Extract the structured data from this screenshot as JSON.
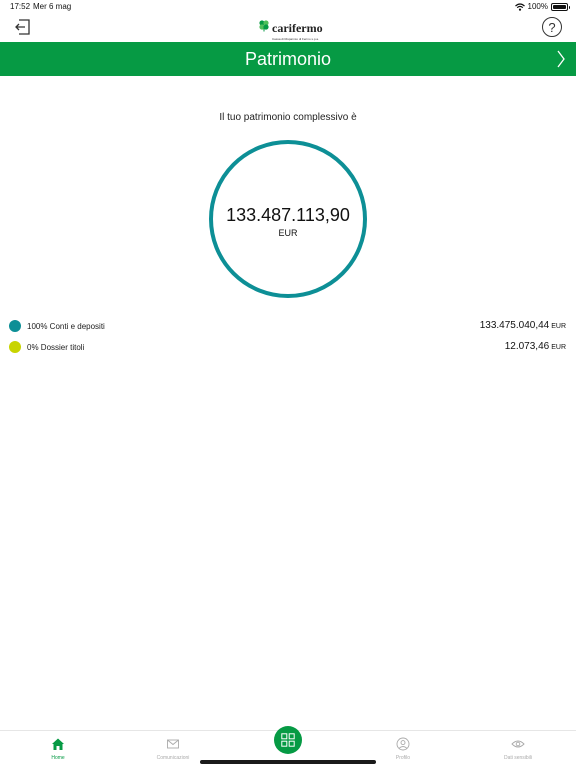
{
  "status_bar": {
    "time": "17:52",
    "date": "Mer 6 mag",
    "battery": "100%",
    "battery_level": 1.0
  },
  "header": {
    "logo_name": "carifermo",
    "logo_subtitle": "Cassa di Risparmio di Fermo s.p.a.",
    "help_label": "?"
  },
  "title_bar": {
    "title": "Patrimonio"
  },
  "summary": {
    "label": "Il tuo patrimonio complessivo è",
    "amount": "133.487.113,90",
    "currency": "EUR"
  },
  "breakdown": [
    {
      "label": "100% Conti e depositi",
      "value": "133.475.040,44",
      "currency": "EUR",
      "color": "#0d8f96"
    },
    {
      "label": "0% Dossier titoli",
      "value": "12.073,46",
      "currency": "EUR",
      "color": "#c8d400"
    }
  ],
  "tabs": [
    {
      "label": "Home",
      "icon": "home-icon",
      "active": true
    },
    {
      "label": "Comunicazioni",
      "icon": "envelope-icon",
      "active": false
    },
    {
      "label": "Profilo",
      "icon": "user-icon",
      "active": false
    },
    {
      "label": "Dati sensibili",
      "icon": "eye-icon",
      "active": false
    }
  ],
  "colors": {
    "brand_green": "#069a44",
    "ring_teal": "#0d8f96",
    "inactive_tab": "#aaaaaa"
  }
}
